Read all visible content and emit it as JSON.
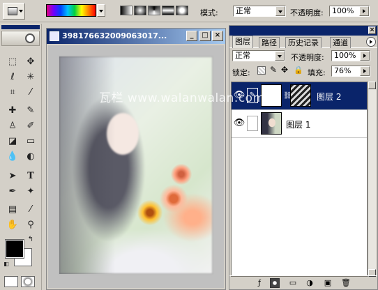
{
  "options_bar": {
    "mode_label": "模式:",
    "mode_value": "正常",
    "opacity_label": "不透明度:",
    "opacity_value": "100%"
  },
  "document": {
    "title": "398176632009063017..."
  },
  "layers_panel": {
    "tabs": [
      "图层",
      "路径",
      "历史记录",
      "通道"
    ],
    "blend_mode": "正常",
    "opacity_label": "不透明度:",
    "opacity_value": "100%",
    "lock_label": "锁定:",
    "fill_label": "填充:",
    "fill_value": "76%",
    "layers": [
      {
        "name": "图层 2",
        "selected": true
      },
      {
        "name": "图层 1",
        "selected": false
      }
    ]
  },
  "watermark": "瓦栏 www.walanwalan.com",
  "colors": {
    "title_bar": "#0a246a",
    "selection": "#0a246a",
    "foreground": "#000000",
    "background": "#ffffff"
  },
  "icons": [
    "marquee-icon",
    "move-icon",
    "lasso-icon",
    "magic-wand-icon",
    "crop-icon",
    "slice-icon",
    "healing-brush-icon",
    "brush-icon",
    "stamp-icon",
    "history-brush-icon",
    "eraser-icon",
    "gradient-icon",
    "blur-icon",
    "dodge-icon",
    "path-select-icon",
    "text-icon",
    "pen-icon",
    "shape-icon",
    "notes-icon",
    "eyedropper-icon",
    "hand-icon",
    "zoom-icon"
  ]
}
